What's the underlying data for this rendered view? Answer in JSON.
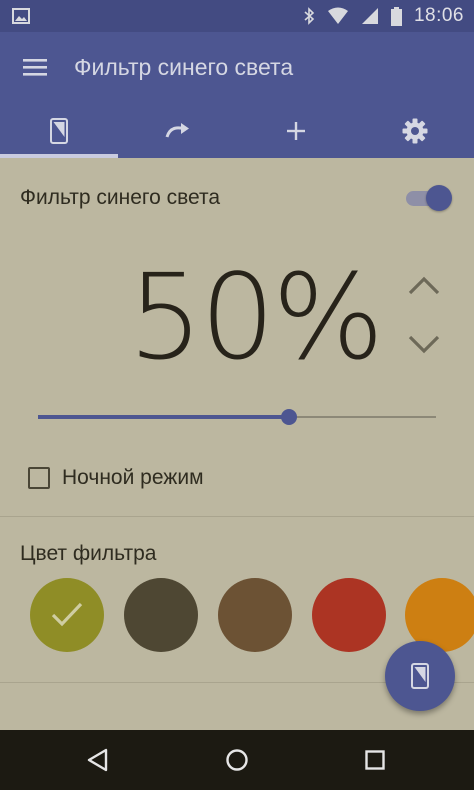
{
  "status_bar": {
    "time": "18:06",
    "icons": [
      "image-icon",
      "bluetooth-icon",
      "wifi-icon",
      "signal-icon",
      "battery-icon"
    ]
  },
  "app_bar": {
    "title": "Фильтр синего света",
    "menu_icon": "hamburger-menu-icon"
  },
  "tabs": [
    {
      "icon": "phone-filter-icon",
      "selected": true
    },
    {
      "icon": "redo-arrow-icon",
      "selected": false
    },
    {
      "icon": "plus-icon",
      "selected": false
    },
    {
      "icon": "gear-icon",
      "selected": false
    }
  ],
  "filter": {
    "label": "Фильтр синего света",
    "enabled": true,
    "intensity_text": "50%",
    "intensity_value": 0.63
  },
  "night_mode": {
    "label": "Ночной режим",
    "checked": false
  },
  "filter_color": {
    "title": "Цвет фильтра",
    "swatches": [
      {
        "color": "#8f8d26",
        "selected": true
      },
      {
        "color": "#4e4733",
        "selected": false
      },
      {
        "color": "#6c5234",
        "selected": false
      },
      {
        "color": "#ac3423",
        "selected": false
      },
      {
        "color": "#cd7f12",
        "selected": false
      }
    ]
  },
  "fab": {
    "icon": "phone-filter-icon"
  },
  "nav_bar": {
    "icons": [
      "back-triangle-icon",
      "home-circle-icon",
      "recents-square-icon"
    ]
  },
  "colors": {
    "accent": "#4d5691",
    "status_bar": "#434b82",
    "background": "#bcb7a0",
    "text": "#2f2c20",
    "nav_bar": "#1c1a12"
  }
}
